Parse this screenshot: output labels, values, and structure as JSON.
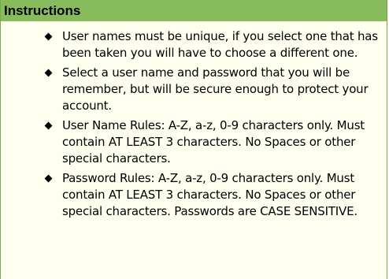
{
  "panel": {
    "title": "Instructions",
    "items": [
      "User names must be unique, if you select one that has been taken you will have to choose a different one.",
      "Select a user name and password that you will be remember, but will be secure enough to protect your account.",
      "User Name Rules: A-Z, a-z, 0-9 characters only. Must contain AT LEAST 3 characters. No Spaces or other special characters.",
      "Password Rules: A-Z, a-z, 0-9 characters only. Must contain AT LEAST 3 characters. No Spaces or other special characters. Passwords are CASE SENSITIVE."
    ]
  },
  "colors": {
    "header_bg": "#88bb5c",
    "panel_bg": "#fffff0",
    "border": "#7aa552"
  },
  "icons": {
    "bullet": "diamond-bullet-icon"
  }
}
